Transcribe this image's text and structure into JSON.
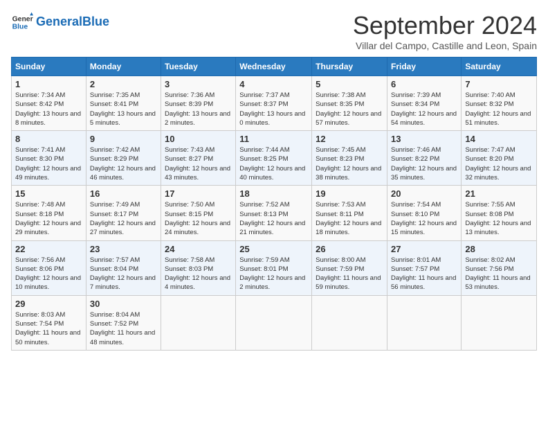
{
  "logo": {
    "text_general": "General",
    "text_blue": "Blue"
  },
  "title": "September 2024",
  "subtitle": "Villar del Campo, Castille and Leon, Spain",
  "days_of_week": [
    "Sunday",
    "Monday",
    "Tuesday",
    "Wednesday",
    "Thursday",
    "Friday",
    "Saturday"
  ],
  "weeks": [
    [
      {
        "day": "1",
        "sunrise": "7:34 AM",
        "sunset": "8:42 PM",
        "daylight": "13 hours and 8 minutes."
      },
      {
        "day": "2",
        "sunrise": "7:35 AM",
        "sunset": "8:41 PM",
        "daylight": "13 hours and 5 minutes."
      },
      {
        "day": "3",
        "sunrise": "7:36 AM",
        "sunset": "8:39 PM",
        "daylight": "13 hours and 2 minutes."
      },
      {
        "day": "4",
        "sunrise": "7:37 AM",
        "sunset": "8:37 PM",
        "daylight": "13 hours and 0 minutes."
      },
      {
        "day": "5",
        "sunrise": "7:38 AM",
        "sunset": "8:35 PM",
        "daylight": "12 hours and 57 minutes."
      },
      {
        "day": "6",
        "sunrise": "7:39 AM",
        "sunset": "8:34 PM",
        "daylight": "12 hours and 54 minutes."
      },
      {
        "day": "7",
        "sunrise": "7:40 AM",
        "sunset": "8:32 PM",
        "daylight": "12 hours and 51 minutes."
      }
    ],
    [
      {
        "day": "8",
        "sunrise": "7:41 AM",
        "sunset": "8:30 PM",
        "daylight": "12 hours and 49 minutes."
      },
      {
        "day": "9",
        "sunrise": "7:42 AM",
        "sunset": "8:29 PM",
        "daylight": "12 hours and 46 minutes."
      },
      {
        "day": "10",
        "sunrise": "7:43 AM",
        "sunset": "8:27 PM",
        "daylight": "12 hours and 43 minutes."
      },
      {
        "day": "11",
        "sunrise": "7:44 AM",
        "sunset": "8:25 PM",
        "daylight": "12 hours and 40 minutes."
      },
      {
        "day": "12",
        "sunrise": "7:45 AM",
        "sunset": "8:23 PM",
        "daylight": "12 hours and 38 minutes."
      },
      {
        "day": "13",
        "sunrise": "7:46 AM",
        "sunset": "8:22 PM",
        "daylight": "12 hours and 35 minutes."
      },
      {
        "day": "14",
        "sunrise": "7:47 AM",
        "sunset": "8:20 PM",
        "daylight": "12 hours and 32 minutes."
      }
    ],
    [
      {
        "day": "15",
        "sunrise": "7:48 AM",
        "sunset": "8:18 PM",
        "daylight": "12 hours and 29 minutes."
      },
      {
        "day": "16",
        "sunrise": "7:49 AM",
        "sunset": "8:17 PM",
        "daylight": "12 hours and 27 minutes."
      },
      {
        "day": "17",
        "sunrise": "7:50 AM",
        "sunset": "8:15 PM",
        "daylight": "12 hours and 24 minutes."
      },
      {
        "day": "18",
        "sunrise": "7:52 AM",
        "sunset": "8:13 PM",
        "daylight": "12 hours and 21 minutes."
      },
      {
        "day": "19",
        "sunrise": "7:53 AM",
        "sunset": "8:11 PM",
        "daylight": "12 hours and 18 minutes."
      },
      {
        "day": "20",
        "sunrise": "7:54 AM",
        "sunset": "8:10 PM",
        "daylight": "12 hours and 15 minutes."
      },
      {
        "day": "21",
        "sunrise": "7:55 AM",
        "sunset": "8:08 PM",
        "daylight": "12 hours and 13 minutes."
      }
    ],
    [
      {
        "day": "22",
        "sunrise": "7:56 AM",
        "sunset": "8:06 PM",
        "daylight": "12 hours and 10 minutes."
      },
      {
        "day": "23",
        "sunrise": "7:57 AM",
        "sunset": "8:04 PM",
        "daylight": "12 hours and 7 minutes."
      },
      {
        "day": "24",
        "sunrise": "7:58 AM",
        "sunset": "8:03 PM",
        "daylight": "12 hours and 4 minutes."
      },
      {
        "day": "25",
        "sunrise": "7:59 AM",
        "sunset": "8:01 PM",
        "daylight": "12 hours and 2 minutes."
      },
      {
        "day": "26",
        "sunrise": "8:00 AM",
        "sunset": "7:59 PM",
        "daylight": "11 hours and 59 minutes."
      },
      {
        "day": "27",
        "sunrise": "8:01 AM",
        "sunset": "7:57 PM",
        "daylight": "11 hours and 56 minutes."
      },
      {
        "day": "28",
        "sunrise": "8:02 AM",
        "sunset": "7:56 PM",
        "daylight": "11 hours and 53 minutes."
      }
    ],
    [
      {
        "day": "29",
        "sunrise": "8:03 AM",
        "sunset": "7:54 PM",
        "daylight": "11 hours and 50 minutes."
      },
      {
        "day": "30",
        "sunrise": "8:04 AM",
        "sunset": "7:52 PM",
        "daylight": "11 hours and 48 minutes."
      },
      null,
      null,
      null,
      null,
      null
    ]
  ],
  "labels": {
    "sunrise": "Sunrise:",
    "sunset": "Sunset:",
    "daylight": "Daylight:"
  }
}
